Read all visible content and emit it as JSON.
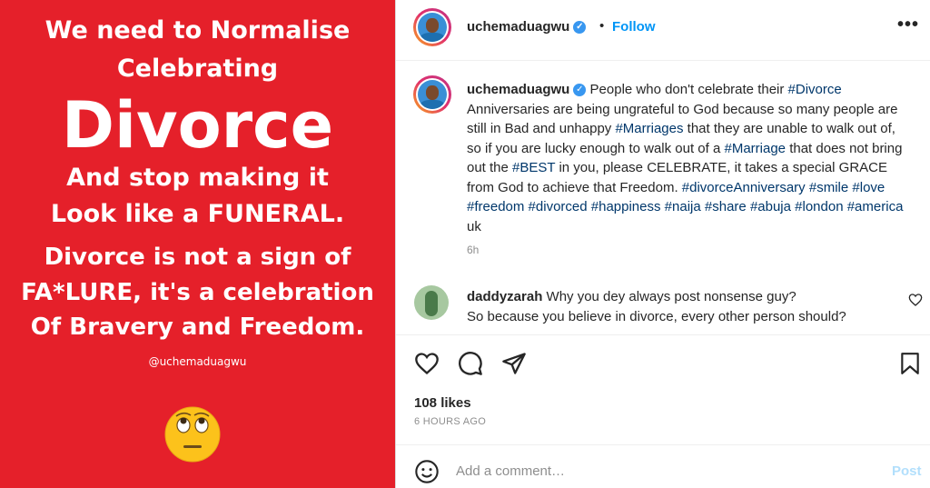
{
  "image": {
    "line1": "We need to Normalise",
    "line2": "Celebrating",
    "line3": "Divorce",
    "line4": "And stop making it",
    "line5": "Look like a FUNERAL.",
    "line6": "Divorce is not a sign of",
    "line7": "FA*LURE, it's a celebration",
    "line8": "Of Bravery and Freedom.",
    "handle": "@uchemaduagwu",
    "emoji": "eye-roll-emoji",
    "bg_color": "#e5202a"
  },
  "header": {
    "username": "uchemaduagwu",
    "dot": "•",
    "follow_label": "Follow",
    "more_label": "•••"
  },
  "caption": {
    "username": "uchemaduagwu",
    "t1": "People who don't celebrate their ",
    "h1": "#Divorce",
    "t2": " Anniversaries are being ungrateful to God because so many people are still in Bad and unhappy ",
    "h2": "#Marriages",
    "t3": " that they are unable to walk out of, so if you are lucky enough to walk out of a ",
    "h3": "#Marriage",
    "t4": " that does not bring out the ",
    "h4": "#BEST",
    "t5": " in you, please CELEBRATE, it takes a special GRACE from God to achieve that Freedom. ",
    "tags": [
      "#divorceAnniversary",
      "#smile",
      "#love",
      "#freedom",
      "#divorced",
      "#happiness",
      "#naija",
      "#share",
      "#abuja",
      "#london",
      "#america"
    ],
    "t6": " uk",
    "time": "6h"
  },
  "comment": {
    "username": "daddyzarah",
    "line1": "Why you dey always post nonsense guy?",
    "line2": "So because you believe in divorce, every other person should?"
  },
  "footer": {
    "likes": "108 likes",
    "time_ago": "6 HOURS AGO",
    "add_comment_placeholder": "Add a comment…",
    "post_label": "Post"
  },
  "colors": {
    "accent": "#0095f6",
    "hashtag": "#00376b",
    "verified": "#3897f0"
  }
}
